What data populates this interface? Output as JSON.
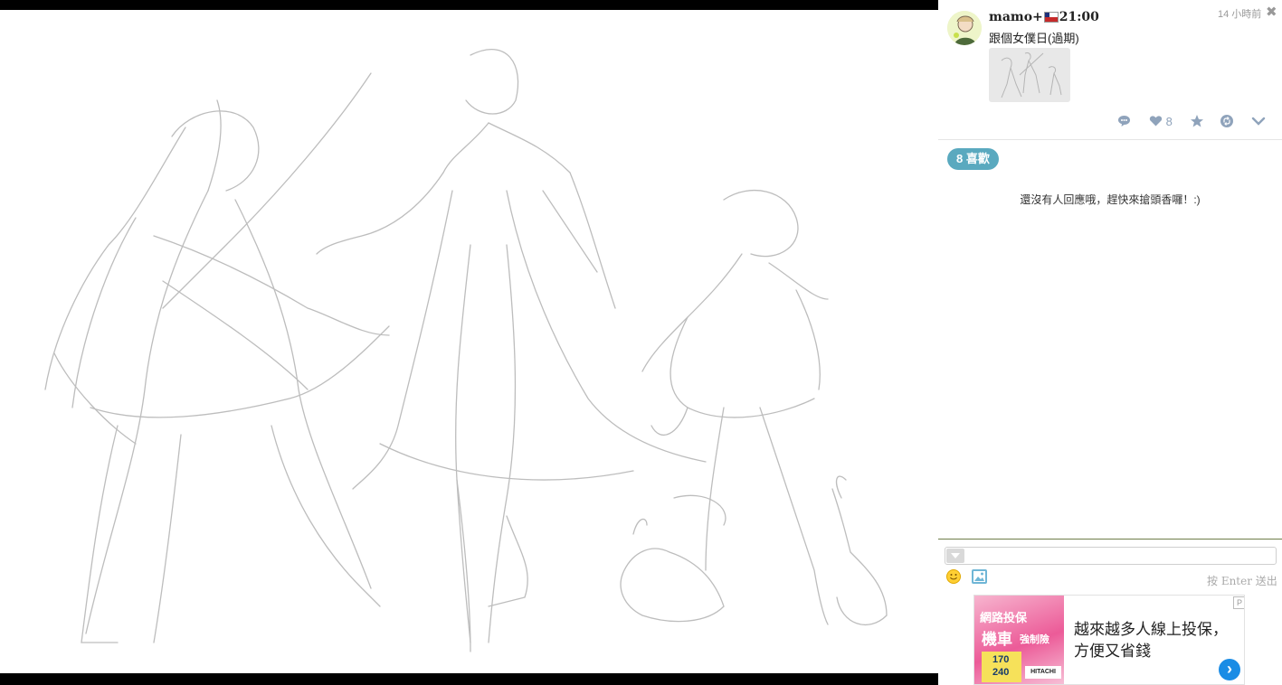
{
  "post": {
    "author": "mamo+",
    "author_suffix": "21:00",
    "time_ago": "14 小時前",
    "close_symbol": "✖",
    "caption": "跟個女僕日(過期)",
    "like_count": "8"
  },
  "likes_badge": "8 喜歡",
  "no_replies": "還沒有人回應哦，趕快來搶頭香囉！:)",
  "reply": {
    "hint": "按 Enter 送出"
  },
  "ad": {
    "text": "越來越多人線上投保，方便又省錢",
    "arrow": "›",
    "tag": "P",
    "banner_lines": [
      "網路投保",
      "機車",
      "強制險",
      "170",
      "240",
      "HITACHI"
    ]
  },
  "colors": {
    "accent": "#5aa9bf",
    "icon": "#8fa3bb",
    "ad_button": "#1a8ce5"
  },
  "icons": [
    "comment-icon",
    "heart-icon",
    "star-icon",
    "reblog-icon",
    "chevron-down-icon",
    "smiley-icon",
    "image-icon",
    "close-icon"
  ]
}
